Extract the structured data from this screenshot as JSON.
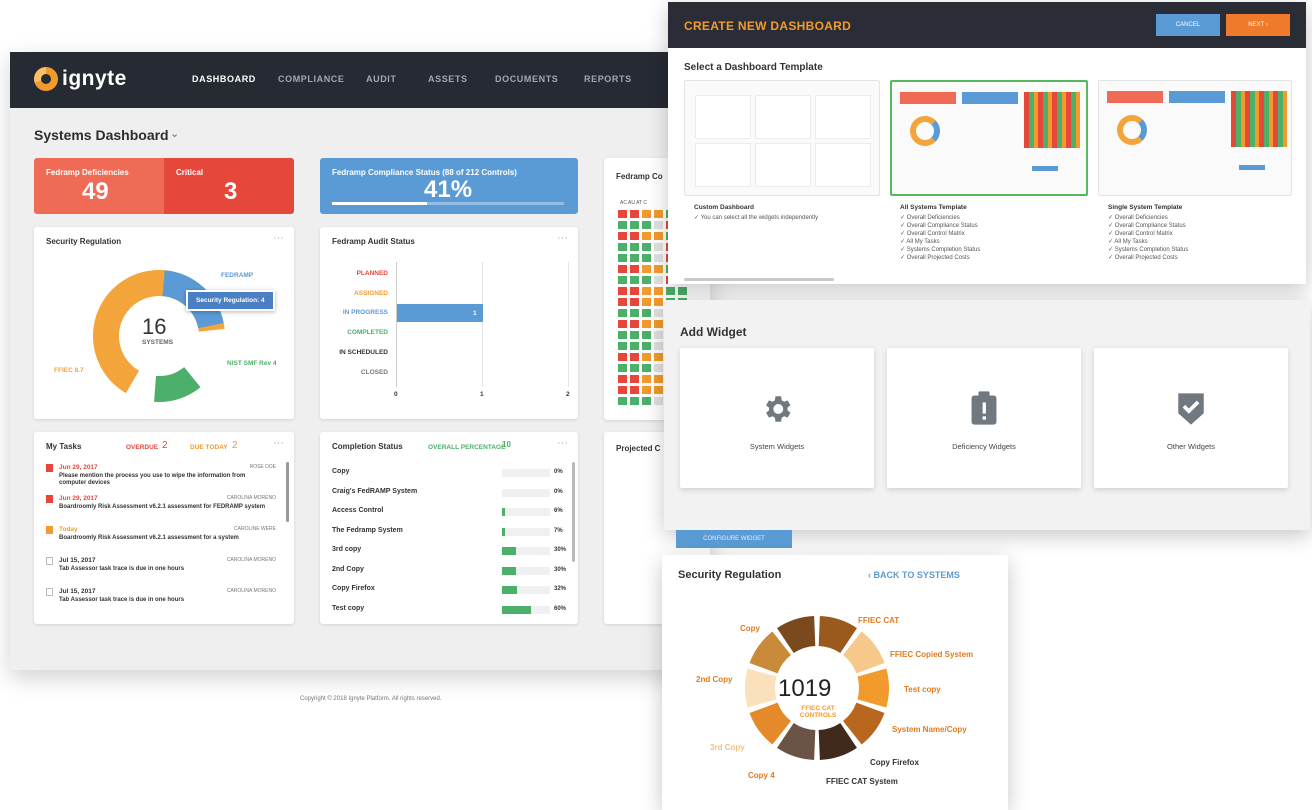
{
  "nav": {
    "logo": "ignyte",
    "items": [
      "DASHBOARD",
      "COMPLIANCE",
      "AUDIT",
      "ASSETS",
      "DOCUMENTS",
      "REPORTS"
    ]
  },
  "page": {
    "title": "Systems Dashboard"
  },
  "stats": {
    "deficiencies": {
      "label": "Fedramp Deficiencies",
      "value": "49"
    },
    "critical": {
      "label": "Critical",
      "value": "3"
    },
    "compliance": {
      "label": "Fedramp Compliance Status (88 of 212 Controls)",
      "value": "41%",
      "progress": 0.41
    },
    "controls_label": "Fedramp Co"
  },
  "security_regulation": {
    "title": "Security Regulation",
    "center_value": "16",
    "center_label": "SYSTEMS",
    "tooltip": "Security Regulation: 4",
    "labels": {
      "fedramp": "FEDRAMP",
      "nist": "NIST SMF Rev 4",
      "ffiec": "FFIEC 8.7"
    },
    "colors": {
      "orange": "#f3a43b",
      "blue": "#5b9bd5",
      "green": "#4caf6a"
    }
  },
  "audit_status": {
    "title": "Fedramp Audit Status",
    "categories": [
      "PLANNED",
      "ASSIGNED",
      "IN PROGRESS",
      "COMPLETED",
      "IN SCHEDULED",
      "CLOSED"
    ],
    "bar_value": "1",
    "axis": [
      "0",
      "1",
      "2"
    ]
  },
  "tasks": {
    "title": "My Tasks",
    "overdue_label": "OVERDUE",
    "overdue_count": "2",
    "due_today_label": "DUE TODAY",
    "due_today_count": "2",
    "items": [
      {
        "date": "Jun 29, 2017",
        "owner": "ROSE DOE",
        "text": "Please mention the process you use to wipe the information from computer devices"
      },
      {
        "date": "Jun 29, 2017",
        "owner": "CAROLINA MORENO",
        "text": "Boardroomly Risk Assessment v6.2.1 assessment for FEDRAMP system"
      },
      {
        "date": "Today",
        "owner": "CAROLINE WERE",
        "text": "Boardroomly Risk Assessment v6.2.1 assessment for a system"
      },
      {
        "date": "Jul 15, 2017",
        "owner": "CAROLINA MORENO",
        "text": "Tab Assessor task trace is due in one hours"
      },
      {
        "date": "Jul 15, 2017",
        "owner": "CAROLINA MORENO",
        "text": "Tab Assessor task trace is due in one hours"
      }
    ]
  },
  "completion": {
    "title": "Completion Status",
    "overall_label": "OVERALL PERCENTAGE",
    "overall_badge": "10",
    "rows": [
      {
        "name": "Copy",
        "pct": 0,
        "label": "0%"
      },
      {
        "name": "Craig's FedRAMP System",
        "pct": 0,
        "label": "0%"
      },
      {
        "name": "Access Control",
        "pct": 6,
        "label": "6%"
      },
      {
        "name": "The Fedramp System",
        "pct": 7,
        "label": "7%"
      },
      {
        "name": "3rd copy",
        "pct": 30,
        "label": "30%"
      },
      {
        "name": "2nd Copy",
        "pct": 30,
        "label": "30%"
      },
      {
        "name": "Copy Firefox",
        "pct": 32,
        "label": "32%"
      },
      {
        "name": "Test copy",
        "pct": 60,
        "label": "60%"
      }
    ]
  },
  "projected_label": "Projected C",
  "create_dashboard": {
    "title": "CREATE NEW DASHBOARD",
    "cancel": "CANCEL",
    "next": "NEXT",
    "select_label": "Select a Dashboard Template",
    "templates": [
      {
        "name": "Custom Dashboard",
        "items": [
          "You can select all the widgets independently"
        ]
      },
      {
        "name": "All Systems Template",
        "items": [
          "Overall Deficiencies",
          "Overall Compliance Status",
          "Overall Control Matrix",
          "All My Tasks",
          "Systems Completion Status",
          "Overall Projected Costs"
        ]
      },
      {
        "name": "Single System Template",
        "items": [
          "Overall Deficiencies",
          "Overall Compliance Status",
          "Overall Control Matrix",
          "All My Tasks",
          "Systems Completion Status",
          "Overall Projected Costs"
        ]
      }
    ]
  },
  "add_widget": {
    "title": "Add Widget",
    "widgets": [
      {
        "label": "System Widgets",
        "icon": "gear-icon"
      },
      {
        "label": "Deficiency Widgets",
        "icon": "clipboard-alert-icon"
      },
      {
        "label": "Other Widgets",
        "icon": "shield-check-icon"
      }
    ],
    "button": "CONFIGURE WIDGET"
  },
  "security_regulation_detail": {
    "title": "Security Regulation",
    "back": "BACK TO SYSTEMS",
    "center_value": "1019",
    "center_label": "FFIEC CAT CONTROLS",
    "slices": [
      {
        "label": "FFIEC CAT",
        "color": "#9a5a1e"
      },
      {
        "label": "FFIEC Copied System",
        "color": "#f6c98a"
      },
      {
        "label": "Test copy",
        "color": "#f39a2d"
      },
      {
        "label": "System Name/Copy",
        "color": "#b9661f"
      },
      {
        "label": "Copy Firefox",
        "color": "#3f2a1c"
      },
      {
        "label": "FFIEC CAT System",
        "color": "#6b5446"
      },
      {
        "label": "Copy 4",
        "color": "#e48a2a"
      },
      {
        "label": "3rd Copy",
        "color": "#fbe1bb"
      },
      {
        "label": "2nd Copy",
        "color": "#c98a3a"
      },
      {
        "label": "Copy",
        "color": "#7a4a1e"
      }
    ]
  },
  "footer": "Copyright © 2018 Ignyte Platform. All rights reserved."
}
